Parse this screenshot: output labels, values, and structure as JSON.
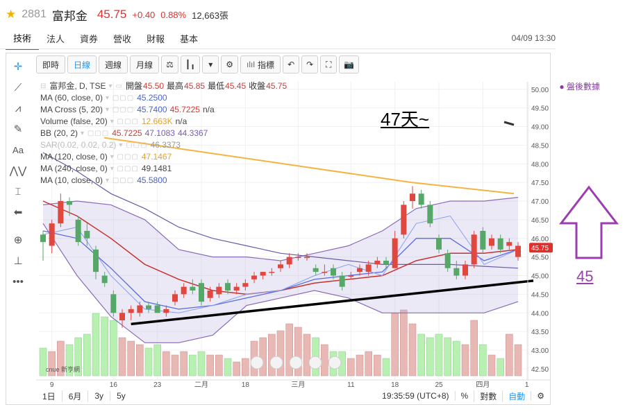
{
  "header": {
    "code": "2881",
    "name": "富邦金",
    "price": "45.75",
    "change": "+0.40",
    "change_pct": "0.88%",
    "volume": "12,663張"
  },
  "nav": {
    "tabs": [
      "技術",
      "法人",
      "資券",
      "營收",
      "財報",
      "基本"
    ],
    "active": 0,
    "datetime": "04/09 13:30"
  },
  "toolbar": {
    "buttons": [
      "即時",
      "日線",
      "週線",
      "月線"
    ],
    "active": 1,
    "indicator_label": "指標"
  },
  "legend": {
    "title": "富邦金, D, TSE",
    "ohlc": [
      {
        "k": "開盤",
        "v": "45.50"
      },
      {
        "k": "最高",
        "v": "45.85"
      },
      {
        "k": "最低",
        "v": "45.45"
      },
      {
        "k": "收盤",
        "v": "45.75"
      }
    ],
    "rows": [
      {
        "name": "MA (60, close, 0)",
        "values": [
          "45.2500"
        ],
        "cls": [
          "v-blue"
        ]
      },
      {
        "name": "MA Cross (5, 20)",
        "values": [
          "45.7400",
          "45.7225",
          "n/a"
        ],
        "cls": [
          "v-blue",
          "v-red",
          "v-dark"
        ]
      },
      {
        "name": "Volume (false, 20)",
        "values": [
          "12.663K",
          "n/a"
        ],
        "cls": [
          "v-orange",
          "v-dark"
        ]
      },
      {
        "name": "BB (20, 2)",
        "values": [
          "45.7225",
          "47.1083",
          "44.3367"
        ],
        "cls": [
          "v-red",
          "v-purple",
          "v-purple"
        ]
      },
      {
        "name": "SAR(0.02, 0.02, 0.2)",
        "values": [
          "46.3373"
        ],
        "cls": [
          "v-gray"
        ]
      },
      {
        "name": "MA (120, close, 0)",
        "values": [
          "47.1467"
        ],
        "cls": [
          "v-orange"
        ]
      },
      {
        "name": "MA (240, close, 0)",
        "values": [
          "49.1481"
        ],
        "cls": [
          "v-dark"
        ]
      },
      {
        "name": "MA (10, close, 0)",
        "values": [
          "45.5800"
        ],
        "cls": [
          "v-blue"
        ]
      }
    ],
    "after_hours": "盤後數據"
  },
  "bottom": {
    "ranges": [
      "1日",
      "6月",
      "3y",
      "5y"
    ],
    "time": "19:35:59 (UTC+8)",
    "percent": "%",
    "log": "對數",
    "auto": "自動"
  },
  "annotations": {
    "days": "47天~",
    "target": "45"
  },
  "logo_text": "cnue 新亨網",
  "chart_data": {
    "type": "candlestick",
    "y_ticks": [
      "50.00",
      "49.50",
      "49.00",
      "48.50",
      "48.00",
      "47.50",
      "47.00",
      "46.50",
      "46.00",
      "45.50",
      "45.00",
      "44.50",
      "44.00",
      "43.50",
      "43.00",
      "42.50"
    ],
    "ylim": [
      42.2,
      50.2
    ],
    "x_ticks": [
      "9",
      "16",
      "23",
      "二月",
      "18",
      "三月",
      "11",
      "18",
      "25",
      "四月",
      "1"
    ],
    "last_price_label": "45.75",
    "candles": [
      {
        "o": 46.1,
        "h": 46.2,
        "l": 45.4,
        "c": 45.9,
        "vol": 0.4
      },
      {
        "o": 45.8,
        "h": 46.5,
        "l": 45.6,
        "c": 46.4,
        "vol": 0.35
      },
      {
        "o": 46.4,
        "h": 47.2,
        "l": 46.3,
        "c": 47.0,
        "vol": 0.5
      },
      {
        "o": 47.0,
        "h": 47.1,
        "l": 46.6,
        "c": 46.9,
        "vol": 0.45
      },
      {
        "o": 46.5,
        "h": 46.6,
        "l": 45.8,
        "c": 45.9,
        "vol": 0.55
      },
      {
        "o": 46.2,
        "h": 46.4,
        "l": 45.8,
        "c": 46.0,
        "vol": 0.6
      },
      {
        "o": 45.7,
        "h": 45.8,
        "l": 44.9,
        "c": 45.1,
        "vol": 0.9
      },
      {
        "o": 45.0,
        "h": 45.1,
        "l": 44.7,
        "c": 44.8,
        "vol": 0.85
      },
      {
        "o": 44.5,
        "h": 44.6,
        "l": 43.9,
        "c": 44.0,
        "vol": 0.8
      },
      {
        "o": 43.8,
        "h": 44.1,
        "l": 43.6,
        "c": 44.0,
        "vol": 0.55
      },
      {
        "o": 44.0,
        "h": 44.2,
        "l": 43.8,
        "c": 44.1,
        "vol": 0.5
      },
      {
        "o": 44.0,
        "h": 44.3,
        "l": 43.9,
        "c": 44.2,
        "vol": 0.45
      },
      {
        "o": 44.2,
        "h": 44.3,
        "l": 44.0,
        "c": 44.1,
        "vol": 0.4
      },
      {
        "o": 44.2,
        "h": 44.3,
        "l": 44.0,
        "c": 44.0,
        "vol": 0.45
      },
      {
        "o": 44.0,
        "h": 44.2,
        "l": 43.9,
        "c": 44.1,
        "vol": 0.35
      },
      {
        "o": 44.3,
        "h": 44.6,
        "l": 44.2,
        "c": 44.5,
        "vol": 0.3
      },
      {
        "o": 44.5,
        "h": 44.8,
        "l": 44.4,
        "c": 44.7,
        "vol": 0.35
      },
      {
        "o": 44.7,
        "h": 44.9,
        "l": 44.5,
        "c": 44.6,
        "vol": 0.3
      },
      {
        "o": 44.8,
        "h": 44.9,
        "l": 44.2,
        "c": 44.3,
        "vol": 0.35
      },
      {
        "o": 44.4,
        "h": 44.7,
        "l": 44.3,
        "c": 44.6,
        "vol": 0.3
      },
      {
        "o": 44.5,
        "h": 44.8,
        "l": 44.4,
        "c": 44.7,
        "vol": 0.3
      },
      {
        "o": 44.8,
        "h": 44.9,
        "l": 44.5,
        "c": 44.6,
        "vol": 0.25
      },
      {
        "o": 44.6,
        "h": 44.8,
        "l": 44.5,
        "c": 44.7,
        "vol": 0.2
      },
      {
        "o": 44.7,
        "h": 44.9,
        "l": 44.6,
        "c": 44.8,
        "vol": 0.25
      },
      {
        "o": 44.9,
        "h": 45.1,
        "l": 44.8,
        "c": 45.0,
        "vol": 0.5
      },
      {
        "o": 45.0,
        "h": 45.1,
        "l": 44.9,
        "c": 45.1,
        "vol": 0.55
      },
      {
        "o": 45.1,
        "h": 45.2,
        "l": 45.0,
        "c": 45.1,
        "vol": 0.6
      },
      {
        "o": 45.2,
        "h": 45.4,
        "l": 45.1,
        "c": 45.3,
        "vol": 0.65
      },
      {
        "o": 45.3,
        "h": 45.6,
        "l": 45.2,
        "c": 45.5,
        "vol": 0.75
      },
      {
        "o": 45.5,
        "h": 45.6,
        "l": 45.4,
        "c": 45.5,
        "vol": 0.7
      },
      {
        "o": 45.5,
        "h": 45.6,
        "l": 45.4,
        "c": 45.5,
        "vol": 0.6
      },
      {
        "o": 45.2,
        "h": 45.3,
        "l": 45.0,
        "c": 45.1,
        "vol": 0.55
      },
      {
        "o": 45.1,
        "h": 45.3,
        "l": 45.0,
        "c": 45.1,
        "vol": 0.45
      },
      {
        "o": 45.2,
        "h": 45.3,
        "l": 44.9,
        "c": 45.0,
        "vol": 0.35
      },
      {
        "o": 45.0,
        "h": 45.1,
        "l": 44.6,
        "c": 44.7,
        "vol": 0.35
      },
      {
        "o": 45.0,
        "h": 45.1,
        "l": 44.9,
        "c": 45.0,
        "vol": 0.25
      },
      {
        "o": 45.1,
        "h": 45.3,
        "l": 45.0,
        "c": 45.2,
        "vol": 0.3
      },
      {
        "o": 45.1,
        "h": 45.4,
        "l": 45.0,
        "c": 45.3,
        "vol": 0.35
      },
      {
        "o": 45.3,
        "h": 45.5,
        "l": 45.2,
        "c": 45.4,
        "vol": 0.3
      },
      {
        "o": 45.4,
        "h": 45.5,
        "l": 45.2,
        "c": 45.3,
        "vol": 0.25
      },
      {
        "o": 45.2,
        "h": 46.2,
        "l": 45.2,
        "c": 46.0,
        "vol": 0.9
      },
      {
        "o": 46.1,
        "h": 47.0,
        "l": 46.0,
        "c": 46.9,
        "vol": 0.95
      },
      {
        "o": 47.0,
        "h": 47.4,
        "l": 46.8,
        "c": 47.2,
        "vol": 0.75
      },
      {
        "o": 47.2,
        "h": 47.3,
        "l": 46.8,
        "c": 46.9,
        "vol": 0.6
      },
      {
        "o": 46.9,
        "h": 47.0,
        "l": 46.3,
        "c": 46.4,
        "vol": 0.55
      },
      {
        "o": 46.0,
        "h": 46.1,
        "l": 45.6,
        "c": 45.7,
        "vol": 0.6
      },
      {
        "o": 45.6,
        "h": 45.7,
        "l": 45.1,
        "c": 45.2,
        "vol": 0.55
      },
      {
        "o": 45.2,
        "h": 45.4,
        "l": 44.9,
        "c": 45.0,
        "vol": 0.5
      },
      {
        "o": 45.0,
        "h": 45.4,
        "l": 44.9,
        "c": 45.3,
        "vol": 0.45
      },
      {
        "o": 45.3,
        "h": 46.2,
        "l": 45.2,
        "c": 46.1,
        "vol": 0.8
      },
      {
        "o": 46.2,
        "h": 46.3,
        "l": 45.6,
        "c": 45.7,
        "vol": 0.45
      },
      {
        "o": 45.8,
        "h": 46.1,
        "l": 45.7,
        "c": 46.0,
        "vol": 0.3
      },
      {
        "o": 46.0,
        "h": 46.1,
        "l": 45.6,
        "c": 45.7,
        "vol": 0.25
      },
      {
        "o": 45.8,
        "h": 46.0,
        "l": 45.7,
        "c": 45.9,
        "vol": 0.6
      },
      {
        "o": 45.5,
        "h": 45.9,
        "l": 45.4,
        "c": 45.8,
        "vol": 0.45
      }
    ],
    "overlays": {
      "ma120": [
        48.7,
        48.3,
        47.9,
        47.5,
        47.2
      ],
      "bb_upper": [
        46.9,
        47.0,
        46.9,
        46.5,
        45.7,
        45.5,
        45.5,
        45.4,
        45.6,
        45.8,
        46.2,
        46.8,
        47.0,
        47.0,
        47.1
      ],
      "bb_lower": [
        46.4,
        45.0,
        43.9,
        43.2,
        43.2,
        43.4,
        44.2,
        44.4,
        44.6,
        44.4,
        44.0,
        44.0,
        44.0,
        44.0,
        44.3
      ],
      "ma60": [
        48.3,
        47.8,
        47.2,
        46.8,
        46.3,
        46.0,
        45.8,
        45.6,
        45.5,
        45.4,
        45.3,
        45.3,
        45.3,
        45.25,
        45.2
      ],
      "ma20": [
        47.0,
        46.6,
        46.0,
        45.3,
        44.9,
        44.6,
        44.5,
        44.6,
        44.8,
        44.9,
        45.0,
        45.4,
        45.6,
        45.6,
        45.7
      ],
      "ma10": [
        46.2,
        46.0,
        45.2,
        44.3,
        44.1,
        44.2,
        44.4,
        44.6,
        44.9,
        45.0,
        45.1,
        46.0,
        46.0,
        45.4,
        45.7
      ],
      "ma5": [
        46.1,
        46.3,
        45.0,
        44.1,
        44.0,
        44.2,
        44.5,
        44.6,
        45.0,
        45.3,
        45.0,
        46.4,
        46.6,
        45.3,
        45.7
      ],
      "ma240": [
        49.3,
        49.2,
        49.1,
        49.1,
        49.1
      ]
    },
    "trendline": [
      [
        10,
        43.7
      ],
      [
        55,
        44.9
      ]
    ]
  }
}
